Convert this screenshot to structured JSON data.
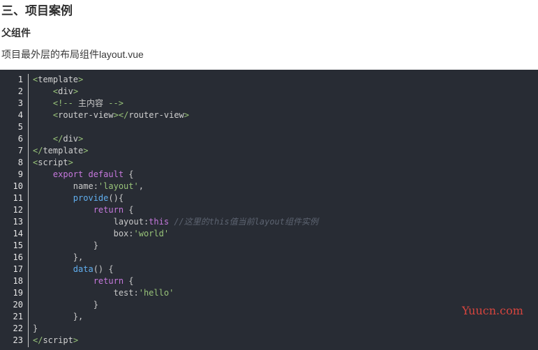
{
  "heading": "三、项目案例",
  "subheading": "父组件",
  "paragraph": "项目最外层的布局组件layout.vue",
  "code": {
    "line_numbers": [
      "1",
      "2",
      "3",
      "4",
      "5",
      "6",
      "7",
      "8",
      "9",
      "10",
      "11",
      "12",
      "13",
      "14",
      "15",
      "16",
      "17",
      "18",
      "19",
      "20",
      "21",
      "22",
      "23"
    ],
    "lines": [
      [
        {
          "t": "<",
          "c": "t-punc"
        },
        {
          "t": "template",
          "c": "t-tag"
        },
        {
          "t": ">",
          "c": "t-punc"
        }
      ],
      [
        {
          "t": "    "
        },
        {
          "t": "<",
          "c": "t-punc"
        },
        {
          "t": "div",
          "c": "t-tag"
        },
        {
          "t": ">",
          "c": "t-punc"
        }
      ],
      [
        {
          "t": "    "
        },
        {
          "t": "<!-- ",
          "c": "t-cmt"
        },
        {
          "t": "主内容",
          "c": "t-plain"
        },
        {
          "t": " -->",
          "c": "t-cmt"
        }
      ],
      [
        {
          "t": "    "
        },
        {
          "t": "<",
          "c": "t-punc"
        },
        {
          "t": "router-view",
          "c": "t-tag"
        },
        {
          "t": "></",
          "c": "t-punc"
        },
        {
          "t": "router-view",
          "c": "t-tag"
        },
        {
          "t": ">",
          "c": "t-punc"
        }
      ],
      [],
      [
        {
          "t": "    "
        },
        {
          "t": "</",
          "c": "t-punc"
        },
        {
          "t": "div",
          "c": "t-tag"
        },
        {
          "t": ">",
          "c": "t-punc"
        }
      ],
      [
        {
          "t": "</",
          "c": "t-punc"
        },
        {
          "t": "template",
          "c": "t-tag"
        },
        {
          "t": ">",
          "c": "t-punc"
        }
      ],
      [
        {
          "t": "<",
          "c": "t-punc"
        },
        {
          "t": "script",
          "c": "t-tag"
        },
        {
          "t": ">",
          "c": "t-punc"
        }
      ],
      [
        {
          "t": "    "
        },
        {
          "t": "export default",
          "c": "t-kw"
        },
        {
          "t": " {",
          "c": "t-plain"
        }
      ],
      [
        {
          "t": "        "
        },
        {
          "t": "name:",
          "c": "t-plain"
        },
        {
          "t": "'layout'",
          "c": "t-str"
        },
        {
          "t": ",",
          "c": "t-plain"
        }
      ],
      [
        {
          "t": "        "
        },
        {
          "t": "provide",
          "c": "t-fn"
        },
        {
          "t": "(){",
          "c": "t-plain"
        }
      ],
      [
        {
          "t": "            "
        },
        {
          "t": "return",
          "c": "t-kw"
        },
        {
          "t": " {",
          "c": "t-plain"
        }
      ],
      [
        {
          "t": "                "
        },
        {
          "t": "layout:",
          "c": "t-plain"
        },
        {
          "t": "this",
          "c": "t-kw"
        },
        {
          "t": " "
        },
        {
          "t": "//这里的this值当前layout组件实例",
          "c": "t-it"
        }
      ],
      [
        {
          "t": "                "
        },
        {
          "t": "box:",
          "c": "t-plain"
        },
        {
          "t": "'world'",
          "c": "t-str"
        }
      ],
      [
        {
          "t": "            "
        },
        {
          "t": "}",
          "c": "t-plain"
        }
      ],
      [
        {
          "t": "        "
        },
        {
          "t": "},",
          "c": "t-plain"
        }
      ],
      [
        {
          "t": "        "
        },
        {
          "t": "data",
          "c": "t-fn"
        },
        {
          "t": "() {",
          "c": "t-plain"
        }
      ],
      [
        {
          "t": "            "
        },
        {
          "t": "return",
          "c": "t-kw"
        },
        {
          "t": " {",
          "c": "t-plain"
        }
      ],
      [
        {
          "t": "                "
        },
        {
          "t": "test:",
          "c": "t-plain"
        },
        {
          "t": "'hello'",
          "c": "t-str"
        }
      ],
      [
        {
          "t": "            "
        },
        {
          "t": "}",
          "c": "t-plain"
        }
      ],
      [
        {
          "t": "        "
        },
        {
          "t": "},",
          "c": "t-plain"
        }
      ],
      [
        {
          "t": "}",
          "c": "t-plain"
        }
      ],
      [
        {
          "t": "</",
          "c": "t-punc"
        },
        {
          "t": "script",
          "c": "t-tag"
        },
        {
          "t": ">",
          "c": "t-punc"
        }
      ]
    ]
  },
  "watermark": "Yuucn.com"
}
